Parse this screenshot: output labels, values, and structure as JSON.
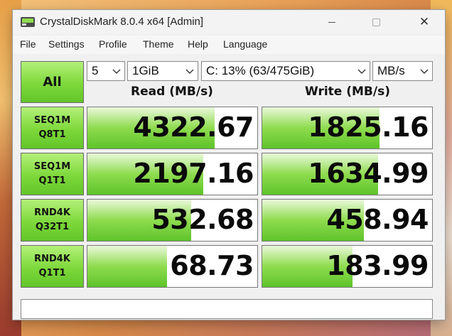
{
  "window": {
    "title": "CrystalDiskMark 8.0.4 x64 [Admin]"
  },
  "menu": [
    "File",
    "Settings",
    "Profile",
    "Theme",
    "Help",
    "Language"
  ],
  "controls": {
    "all_label": "All",
    "test_count": "5",
    "test_size": "1GiB",
    "drive": "C: 13% (63/475GiB)",
    "unit": "MB/s"
  },
  "headers": {
    "read": "Read (MB/s)",
    "write": "Write (MB/s)"
  },
  "tests": [
    {
      "line1": "SEQ1M",
      "line2": "Q8T1",
      "read": "4322.67",
      "write": "1825.16",
      "read_fill": 0.75,
      "write_fill": 0.69
    },
    {
      "line1": "SEQ1M",
      "line2": "Q1T1",
      "read": "2197.16",
      "write": "1634.99",
      "read_fill": 0.68,
      "write_fill": 0.68
    },
    {
      "line1": "RND4K",
      "line2": "Q32T1",
      "read": "532.68",
      "write": "458.94",
      "read_fill": 0.61,
      "write_fill": 0.6
    },
    {
      "line1": "RND4K",
      "line2": "Q1T1",
      "read": "68.73",
      "write": "183.99",
      "read_fill": 0.47,
      "write_fill": 0.53
    }
  ],
  "status_text": "",
  "colors": {
    "accent_green": "#7dd83a",
    "bar_green": "#8fdc4f"
  }
}
